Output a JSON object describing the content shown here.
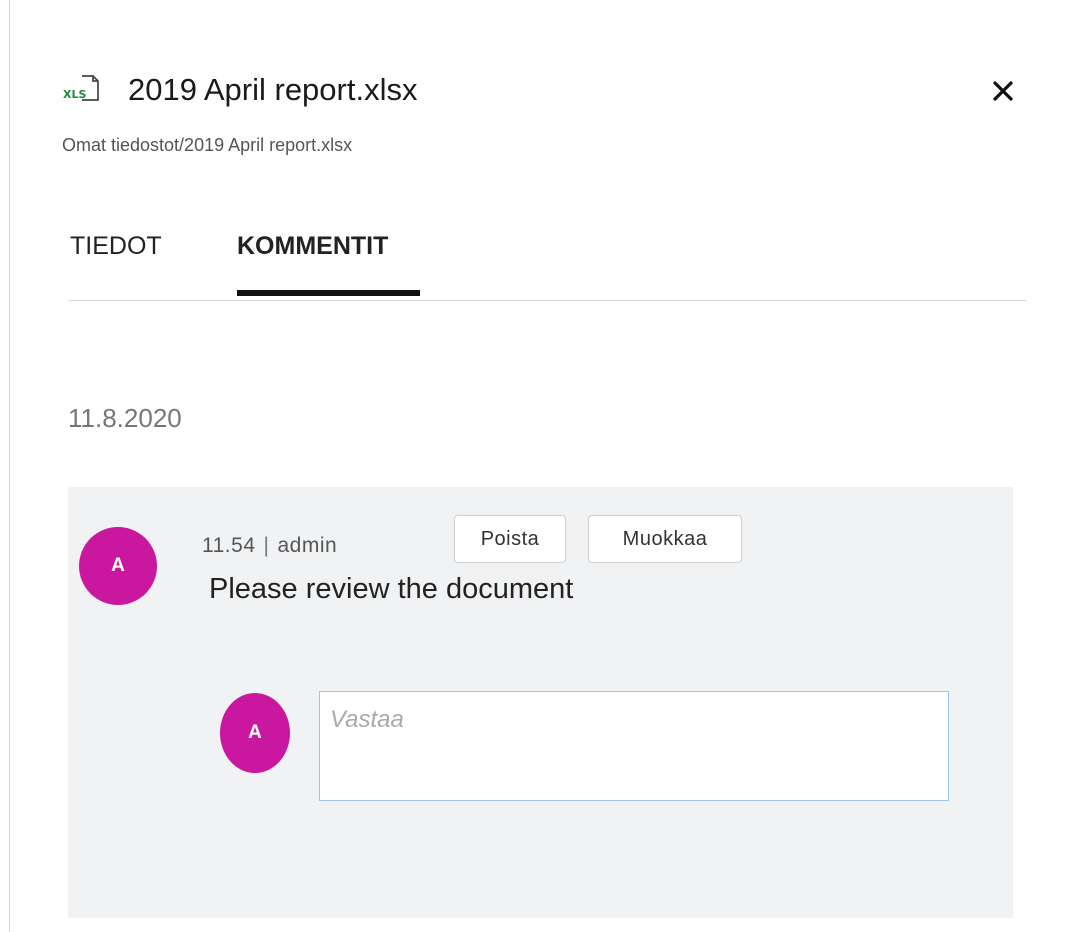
{
  "file": {
    "icon": "xls-file-icon",
    "icon_text": "XLS",
    "title": "2019 April report.xlsx",
    "path": "Omat tiedostot/2019 April report.xlsx"
  },
  "close": {
    "icon": "close-icon"
  },
  "tabs": [
    {
      "label": "TIEDOT",
      "active": false
    },
    {
      "label": "KOMMENTIT",
      "active": true
    }
  ],
  "comments": {
    "date": "11.8.2020",
    "items": [
      {
        "avatar_initial": "A",
        "time": "11.54",
        "separator": "|",
        "author": "admin",
        "text": "Please review the document",
        "actions": {
          "delete_label": "Poista",
          "edit_label": "Muokkaa"
        }
      }
    ],
    "reply": {
      "avatar_initial": "A",
      "placeholder": "Vastaa",
      "value": ""
    }
  },
  "colors": {
    "avatar": "#c9189f",
    "xls_icon": "#1e8a3e",
    "panel_background": "#f1f2f4",
    "input_border": "#9fc3ee"
  }
}
